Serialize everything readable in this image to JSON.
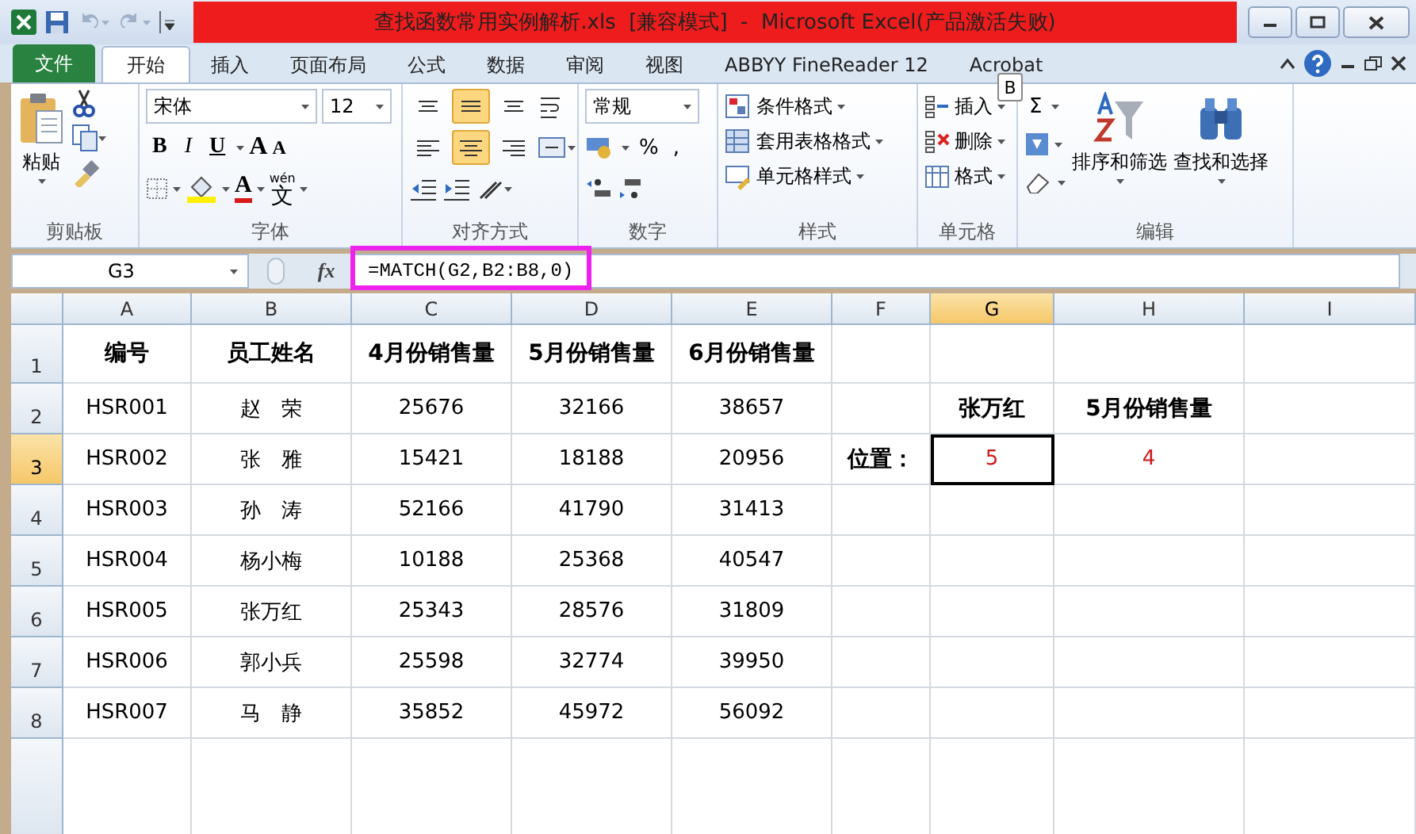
{
  "title_bar": {
    "title": "查找函数常用实例解析.xls  [兼容模式]  -  Microsoft Excel(产品激活失败)"
  },
  "tabs": [
    {
      "label": "文件",
      "kind": "file",
      "selected": false
    },
    {
      "label": "开始",
      "kind": "tab",
      "selected": true
    },
    {
      "label": "插入",
      "kind": "tab",
      "selected": false
    },
    {
      "label": "页面布局",
      "kind": "tab",
      "selected": false
    },
    {
      "label": "公式",
      "kind": "tab",
      "selected": false
    },
    {
      "label": "数据",
      "kind": "tab",
      "selected": false
    },
    {
      "label": "审阅",
      "kind": "tab",
      "selected": false
    },
    {
      "label": "视图",
      "kind": "tab",
      "selected": false
    },
    {
      "label": "ABBYY FineReader 12",
      "kind": "tab",
      "selected": false
    },
    {
      "label": "Acrobat",
      "kind": "tab",
      "selected": false
    }
  ],
  "keytip": "B",
  "ribbon": {
    "clipboard": {
      "label": "剪贴板",
      "paste": "粘贴"
    },
    "font": {
      "label": "字体",
      "font_name": "宋体",
      "font_size": "12",
      "bold": "B",
      "italic": "I",
      "underline": "U",
      "grow": "A",
      "shrink": "A",
      "font_color": "A",
      "phonetic_top": "wén",
      "phonetic_main": "文"
    },
    "alignment": {
      "label": "对齐方式",
      "vertical": [
        {
          "kind": "top",
          "selected": false
        },
        {
          "kind": "middle",
          "selected": true
        },
        {
          "kind": "bottom",
          "selected": false
        }
      ],
      "horizontal": [
        {
          "kind": "left",
          "selected": false
        },
        {
          "kind": "center",
          "selected": true
        },
        {
          "kind": "right",
          "selected": false
        }
      ]
    },
    "number": {
      "label": "数字",
      "format": "常规",
      "percent": "%",
      "comma": ","
    },
    "styles": {
      "label": "样式",
      "items": [
        "条件格式",
        "套用表格格式",
        "单元格样式"
      ]
    },
    "cells": {
      "label": "单元格",
      "items": [
        "插入",
        "删除",
        "格式"
      ]
    },
    "editing": {
      "label": "编辑",
      "sum": "Σ",
      "sort": "排序和筛选",
      "find": "查找和选择"
    }
  },
  "formula_bar": {
    "name_box": "G3",
    "fx": "fx",
    "formula": "=MATCH(G2,B2:B8,0)"
  },
  "sheet": {
    "columns": [
      {
        "label": "A",
        "selected": false
      },
      {
        "label": "B",
        "selected": false
      },
      {
        "label": "C",
        "selected": false
      },
      {
        "label": "D",
        "selected": false
      },
      {
        "label": "E",
        "selected": false
      },
      {
        "label": "F",
        "selected": false
      },
      {
        "label": "G",
        "selected": true
      },
      {
        "label": "H",
        "selected": false
      },
      {
        "label": "I",
        "selected": false
      }
    ],
    "rows": [
      {
        "label": "1",
        "selected": false,
        "cells": [
          {
            "text": "编号",
            "kind": "heading",
            "selected": false
          },
          {
            "text": "员工姓名",
            "kind": "heading",
            "selected": false
          },
          {
            "text": "4月份销售量",
            "kind": "heading",
            "selected": false
          },
          {
            "text": "5月份销售量",
            "kind": "heading",
            "selected": false
          },
          {
            "text": "6月份销售量",
            "kind": "heading",
            "selected": false
          },
          null,
          null,
          null,
          null
        ]
      },
      {
        "label": "2",
        "selected": false,
        "cells": [
          {
            "text": "HSR001",
            "kind": "value",
            "selected": false
          },
          {
            "text": "赵　荣",
            "kind": "value",
            "selected": false
          },
          {
            "text": "25676",
            "kind": "value",
            "selected": false
          },
          {
            "text": "32166",
            "kind": "value",
            "selected": false
          },
          {
            "text": "38657",
            "kind": "value",
            "selected": false
          },
          null,
          {
            "text": "张万红",
            "kind": "heading",
            "selected": false
          },
          {
            "text": "5月份销售量",
            "kind": "heading",
            "selected": false
          },
          null
        ]
      },
      {
        "label": "3",
        "selected": true,
        "cells": [
          {
            "text": "HSR002",
            "kind": "value",
            "selected": false
          },
          {
            "text": "张　雅",
            "kind": "value",
            "selected": false
          },
          {
            "text": "15421",
            "kind": "value",
            "selected": false
          },
          {
            "text": "18188",
            "kind": "value",
            "selected": false
          },
          {
            "text": "20956",
            "kind": "value",
            "selected": false
          },
          {
            "text": "位置：",
            "kind": "heading",
            "selected": false
          },
          {
            "text": "5",
            "kind": "result",
            "selected": true
          },
          {
            "text": "4",
            "kind": "result",
            "selected": false
          },
          null
        ]
      },
      {
        "label": "4",
        "selected": false,
        "cells": [
          {
            "text": "HSR003",
            "kind": "value",
            "selected": false
          },
          {
            "text": "孙　涛",
            "kind": "value",
            "selected": false
          },
          {
            "text": "52166",
            "kind": "value",
            "selected": false
          },
          {
            "text": "41790",
            "kind": "value",
            "selected": false
          },
          {
            "text": "31413",
            "kind": "value",
            "selected": false
          },
          null,
          null,
          null,
          null
        ]
      },
      {
        "label": "5",
        "selected": false,
        "cells": [
          {
            "text": "HSR004",
            "kind": "value",
            "selected": false
          },
          {
            "text": "杨小梅",
            "kind": "value",
            "selected": false
          },
          {
            "text": "10188",
            "kind": "value",
            "selected": false
          },
          {
            "text": "25368",
            "kind": "value",
            "selected": false
          },
          {
            "text": "40547",
            "kind": "value",
            "selected": false
          },
          null,
          null,
          null,
          null
        ]
      },
      {
        "label": "6",
        "selected": false,
        "cells": [
          {
            "text": "HSR005",
            "kind": "value",
            "selected": false
          },
          {
            "text": "张万红",
            "kind": "value",
            "selected": false
          },
          {
            "text": "25343",
            "kind": "value",
            "selected": false
          },
          {
            "text": "28576",
            "kind": "value",
            "selected": false
          },
          {
            "text": "31809",
            "kind": "value",
            "selected": false
          },
          null,
          null,
          null,
          null
        ]
      },
      {
        "label": "7",
        "selected": false,
        "cells": [
          {
            "text": "HSR006",
            "kind": "value",
            "selected": false
          },
          {
            "text": "郭小兵",
            "kind": "value",
            "selected": false
          },
          {
            "text": "25598",
            "kind": "value",
            "selected": false
          },
          {
            "text": "32774",
            "kind": "value",
            "selected": false
          },
          {
            "text": "39950",
            "kind": "value",
            "selected": false
          },
          null,
          null,
          null,
          null
        ]
      },
      {
        "label": "8",
        "selected": false,
        "cells": [
          {
            "text": "HSR007",
            "kind": "value",
            "selected": false
          },
          {
            "text": "马　静",
            "kind": "value",
            "selected": false
          },
          {
            "text": "35852",
            "kind": "value",
            "selected": false
          },
          {
            "text": "45972",
            "kind": "value",
            "selected": false
          },
          {
            "text": "56092",
            "kind": "value",
            "selected": false
          },
          null,
          null,
          null,
          null
        ]
      }
    ]
  },
  "highlight_frame": {
    "visible": true
  }
}
